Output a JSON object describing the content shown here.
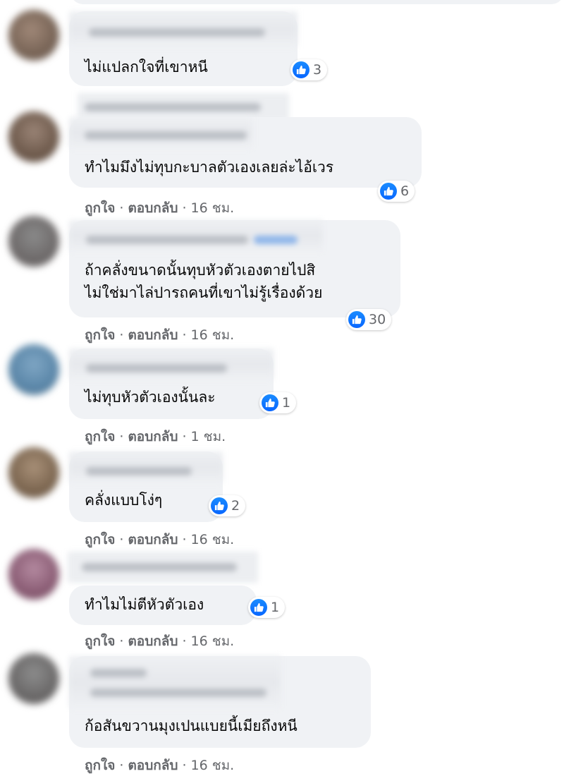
{
  "colors": {
    "bubble": "#f0f2f5",
    "like_blue": "#0866ff",
    "meta_text": "#65676b",
    "text": "#050505"
  },
  "action_labels": {
    "like": "ถูกใจ",
    "reply": "ตอบกลับ",
    "separator": "·"
  },
  "comments": [
    {
      "text_lines": [
        "ไม่แปลกใจที่เขาหนี"
      ],
      "reactions": {
        "icon": "like-icon",
        "count": "3"
      },
      "time": ""
    },
    {
      "text_lines": [
        "ทำไมมึงไม่ทุบกะบาลตัวเองเลยล่ะไอ้เวร"
      ],
      "reactions": {
        "icon": "like-icon",
        "count": "6"
      },
      "time": "16 ชม."
    },
    {
      "text_lines": [
        "ถ้าคลั่งขนาดนั้นทุบหัวตัวเองตายไปสิ",
        "ไม่ใช่มาไล่ปารถคนที่เขาไม่รู้เรื่องด้วย"
      ],
      "reactions": {
        "icon": "like-icon",
        "count": "30"
      },
      "time": "16 ชม."
    },
    {
      "text_lines": [
        "ไม่ทุบหัวตัวเองนั้นละ"
      ],
      "reactions": {
        "icon": "like-icon",
        "count": "1"
      },
      "time": "1 ชม."
    },
    {
      "text_lines": [
        "คลั่งแบบโง่ๆ"
      ],
      "reactions": {
        "icon": "like-icon",
        "count": "2"
      },
      "time": "16 ชม."
    },
    {
      "text_lines": [
        "ทำไมไม่ตีหัวตัวเอง"
      ],
      "reactions": {
        "icon": "like-icon",
        "count": "1"
      },
      "time": "16 ชม."
    },
    {
      "text_lines": [
        "ก้อสันขวานมุงเปนแบยนี้เมียถึงหนี"
      ],
      "time": "16 ชม."
    }
  ]
}
